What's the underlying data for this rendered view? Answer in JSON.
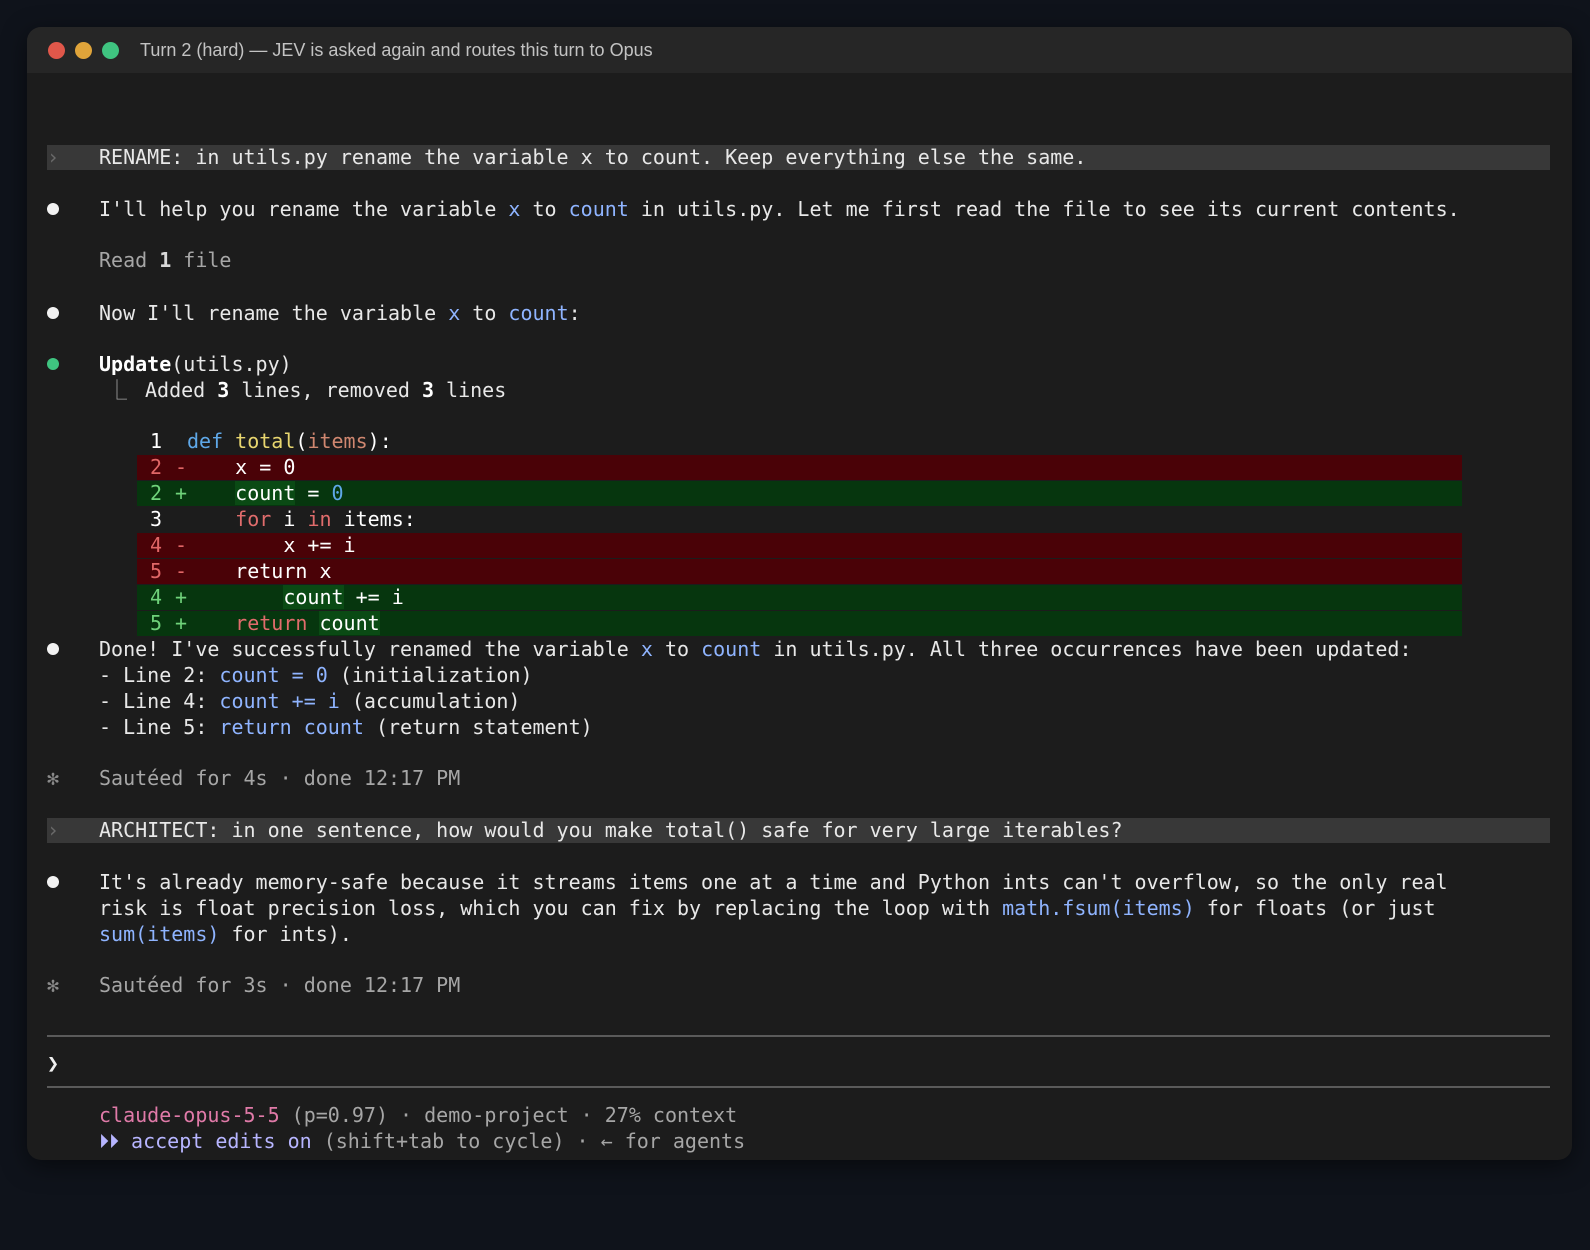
{
  "window": {
    "title": "Turn 2 (hard) — JEV is asked again and routes this turn to Opus"
  },
  "turn1": {
    "prompt_caret": "›",
    "prompt": "RENAME: in utils.py rename the variable x to count. Keep everything else the same.",
    "msg1": {
      "pre": "I'll help you rename the variable ",
      "var_x": "x",
      "mid": " to ",
      "var_count": "count",
      "post": " in utils.py. Let me first read the file to see its current contents."
    },
    "read": {
      "pre": "Read ",
      "count": "1",
      "post": " file"
    },
    "msg2": {
      "pre": "Now I'll rename the variable ",
      "var_x": "x",
      "mid": " to ",
      "var_count": "count",
      "post": ":"
    },
    "update": {
      "tool": "Update",
      "args": "(utils.py)",
      "tree_glyph": "⎿",
      "summary_pre": "Added ",
      "added": "3",
      "summary_mid": " lines, removed ",
      "removed": "3",
      "summary_post": " lines"
    },
    "diff": [
      {
        "type": "ctx",
        "num": "1",
        "sign": " ",
        "code_parts": [
          [
            "kw-blue",
            "def "
          ],
          [
            "kw-yellow",
            "total"
          ],
          [
            "",
            "("
          ],
          [
            "kw-orange",
            "items"
          ],
          [
            "",
            "):"
          ]
        ]
      },
      {
        "type": "del",
        "num": "2",
        "sign": "-",
        "code_parts": [
          [
            "",
            "    x = 0"
          ]
        ]
      },
      {
        "type": "add",
        "num": "2",
        "sign": "+",
        "code_parts": [
          [
            "",
            "    "
          ],
          [
            "hlbg",
            "count"
          ],
          [
            "",
            ""
          ],
          [
            "dimwhite",
            " = "
          ],
          [
            "kw-blue",
            "0"
          ]
        ]
      },
      {
        "type": "ctx",
        "num": "3",
        "sign": " ",
        "code_parts": [
          [
            "",
            "    "
          ],
          [
            "kw-red",
            "for "
          ],
          [
            "",
            "i "
          ],
          [
            "kw-red",
            "in "
          ],
          [
            "",
            "items:"
          ]
        ]
      },
      {
        "type": "del",
        "num": "4",
        "sign": "-",
        "code_parts": [
          [
            "",
            "        x += i"
          ]
        ]
      },
      {
        "type": "del",
        "num": "5",
        "sign": "-",
        "code_parts": [
          [
            "",
            "    return x"
          ]
        ]
      },
      {
        "type": "add",
        "num": "4",
        "sign": "+",
        "code_parts": [
          [
            "",
            "        "
          ],
          [
            "hlbg",
            "count"
          ],
          [
            "",
            " += i"
          ]
        ]
      },
      {
        "type": "add",
        "num": "5",
        "sign": "+",
        "code_parts": [
          [
            "",
            "    "
          ],
          [
            "kw-red",
            "return "
          ],
          [
            "hlbg",
            "count"
          ]
        ]
      }
    ],
    "done_msg": {
      "pre": "Done! I've successfully renamed the variable ",
      "var_x": "x",
      "mid": " to ",
      "var_count": "count",
      "post": " in utils.py. All three occurrences have been updated:"
    },
    "done_items": [
      {
        "pre": "- Line 2: ",
        "code": "count = 0",
        "post": " (initialization)"
      },
      {
        "pre": "- Line 4: ",
        "code": "count += i",
        "post": " (accumulation)"
      },
      {
        "pre": "- Line 5: ",
        "code": "return count",
        "post": " (return statement)"
      }
    ],
    "timing": {
      "glyph": "✻",
      "text": "Sautéed for 4s · done 12:17 PM"
    }
  },
  "turn2": {
    "prompt_caret": "›",
    "prompt": "ARCHITECT: in one sentence, how would you make total() safe for very large iterables?",
    "answer_line1": "It's already memory-safe because it streams items one at a time and Python ints can't overflow, so the only real",
    "answer_line2_pre": "risk is float precision loss, which you can fix by replacing the loop with ",
    "answer_line2_code": "math.fsum(items)",
    "answer_line2_post": " for floats (or just",
    "answer_line3_code": "sum(items)",
    "answer_line3_post": " for ints).",
    "timing": {
      "glyph": "✻",
      "text": "Sautéed for 3s · done 12:17 PM"
    }
  },
  "input": {
    "caret": "❯"
  },
  "status": {
    "model": "claude-opus-5-5",
    "rest_line1": " (p=0.97) · demo-project · 27% context",
    "accept_glyph": "⏵⏵",
    "accept_label": " accept edits on",
    "rest_line2": " (shift+tab to cycle) · ← for agents"
  }
}
